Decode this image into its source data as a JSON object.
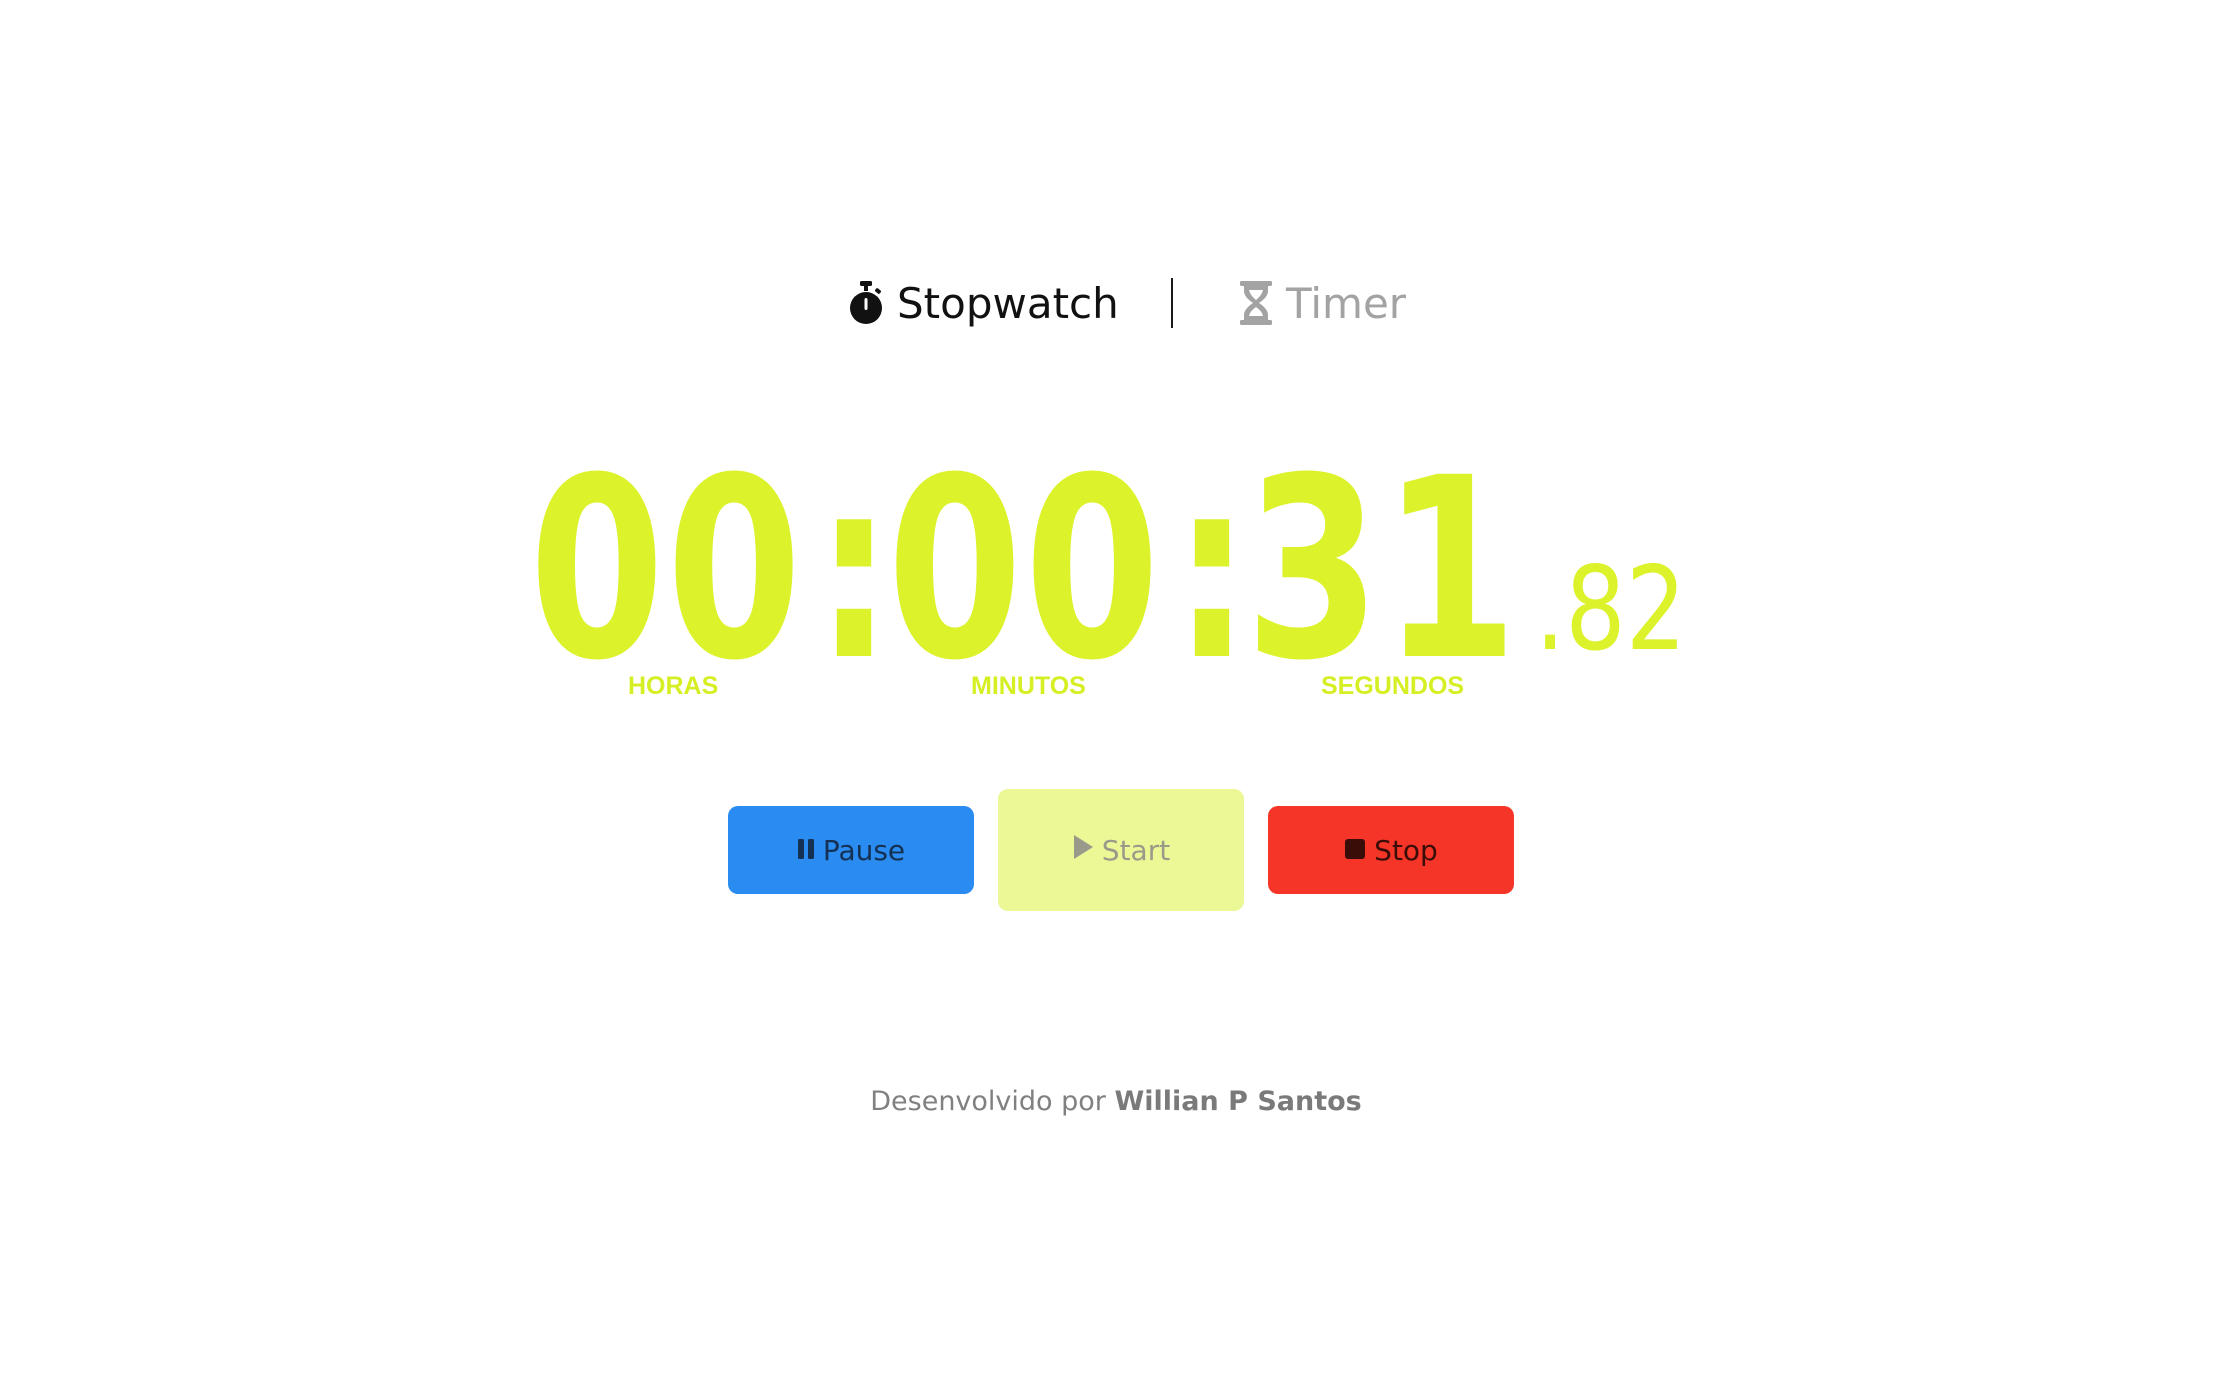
{
  "tabs": [
    {
      "label": "Stopwatch",
      "icon": "stopwatch-icon",
      "active": true
    },
    {
      "label": "Timer",
      "icon": "hourglass-icon",
      "active": false
    }
  ],
  "clock": {
    "hours": "00",
    "minutes": "00",
    "seconds": "31",
    "separator": ":",
    "centiseconds": ".82",
    "units": {
      "hours": "HORAS",
      "minutes": "MINUTOS",
      "seconds": "SEGUNDOS"
    },
    "color": "#dcf22a"
  },
  "buttons": {
    "pause": {
      "label": "Pause",
      "icon": "pause-icon",
      "color": "#2a8bf0"
    },
    "start": {
      "label": "Start",
      "icon": "play-icon",
      "color": "#ecf796",
      "disabled": true
    },
    "stop": {
      "label": "Stop",
      "icon": "stop-icon",
      "color": "#f43527"
    }
  },
  "footer": {
    "prefix": "Desenvolvido por",
    "author": "Willian P Santos"
  }
}
